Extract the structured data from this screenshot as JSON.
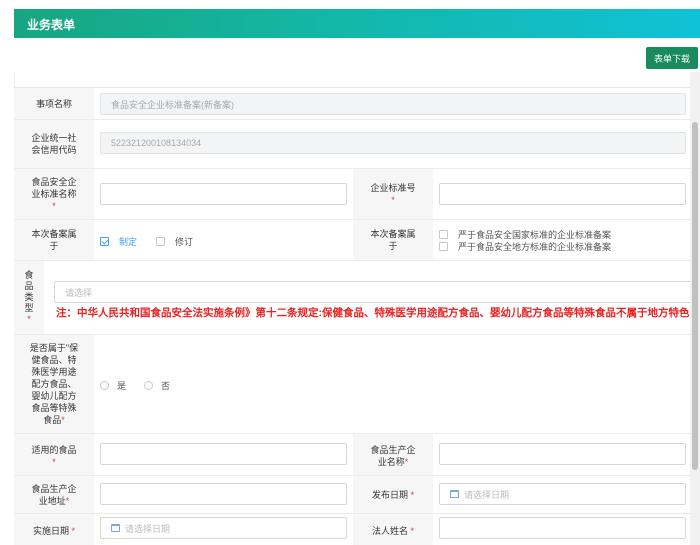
{
  "header": {
    "title": "业务表单"
  },
  "toolbar": {
    "download_label": "表单下载"
  },
  "form": {
    "item_name": {
      "label": "事项名称",
      "value": "食品安全企业标准备案(新备案)"
    },
    "credit_code": {
      "label": "企业统一社会信用代码",
      "value": "522321200108134034"
    },
    "standard_name": {
      "label": "食品安全企业标准名称",
      "required": "*",
      "placeholder": ""
    },
    "standard_no": {
      "label": "企业标准号",
      "required": "*",
      "placeholder": ""
    },
    "record_type1": {
      "label": "本次备案属于",
      "options": [
        "制定",
        "修订"
      ],
      "selected": "制定"
    },
    "record_type2": {
      "label": "本次备案属于",
      "options": [
        "严于食品安全国家标准的企业标准备案",
        "严于食品安全地方标准的企业标准备案"
      ]
    },
    "food_type": {
      "label": "食品类型",
      "required": "*",
      "placeholder": "请选择",
      "note": "注：中华人民共和国食品安全法实施条例》第十二条规定:保健食品、特殊医学用途配方食品、婴幼儿配方食品等特殊食品不属于地方特色食"
    },
    "special_food": {
      "label": "是否属于\"保健食品、特殊医学用途配方食品、婴幼儿配方食品等特殊食品",
      "required": "*",
      "options": [
        "是",
        "否"
      ]
    },
    "applicable_food": {
      "label": "适用的食品",
      "required": "*"
    },
    "producer_name": {
      "label": "食品生产企业名称",
      "required": "*"
    },
    "producer_address": {
      "label": "食品生产企业地址",
      "required": "*"
    },
    "publish_date": {
      "label": "发布日期",
      "required": "*",
      "placeholder": "请选择日期"
    },
    "effective_date": {
      "label": "实施日期",
      "required": "*",
      "placeholder": "请选择日期"
    },
    "legal_person": {
      "label": "法人姓名",
      "required": "*"
    }
  }
}
